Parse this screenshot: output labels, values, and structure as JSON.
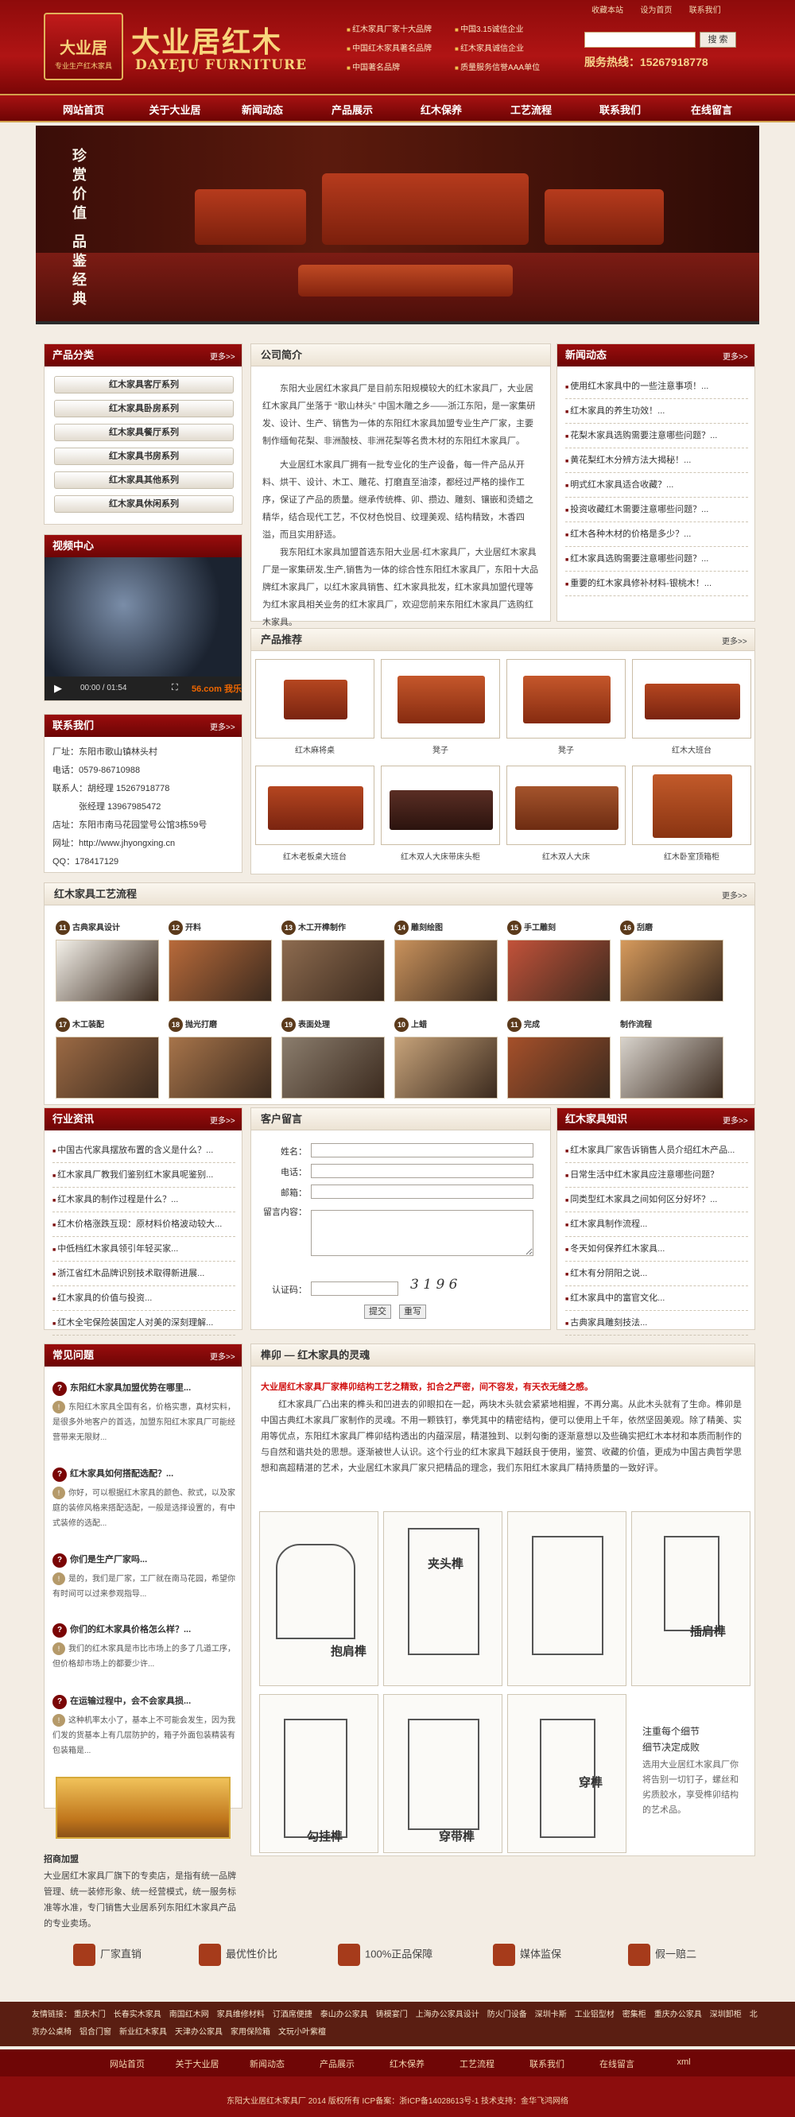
{
  "header": {
    "logo_text": "大业居",
    "logo_sub": "专业生产红木家具",
    "brand_cn": "大业居红木",
    "brand_en": "DAYEJU FURNITURE",
    "honors": [
      "红木家具厂家十大品牌",
      "中国3.15诚信企业",
      "中国红木家具著名品牌",
      "红木家具诚信企业",
      "中国著名品牌",
      "质量服务信誉AAA单位"
    ],
    "top_links": [
      "收藏本站",
      "设为首页",
      "联系我们"
    ],
    "search_button": "搜 索",
    "hotline": "服务热线：15267918778"
  },
  "nav": [
    "网站首页",
    "关于大业居",
    "新闻动态",
    "产品展示",
    "红木保养",
    "工艺流程",
    "联系我们",
    "在线留言"
  ],
  "banner": {
    "slogan": "珍赏价值 品鉴经典"
  },
  "categories": {
    "title": "产品分类",
    "more": "更多>>",
    "items": [
      "红木家具客厅系列",
      "红木家具卧房系列",
      "红木家具餐厅系列",
      "红木家具书房系列",
      "红木家具其他系列",
      "红木家具休闲系列"
    ]
  },
  "company": {
    "title": "公司简介",
    "p1": "东阳大业居红木家具厂是目前东阳规模较大的红木家具厂，大业居红木家具厂坐落于 “歌山林头” 中国木雕之乡——浙江东阳，是一家集研发、设计、生产、销售为一体的东阳红木家具加盟专业生产厂家，主要制作缅甸花梨、非洲酸枝、非洲花梨等名贵木材的东阳红木家具厂。",
    "p2": "大业居红木家具厂拥有一批专业化的生产设备，每一件产品从开料、烘干、设计、木工、雕花、打磨直至油漆，都经过严格的操作工序，保证了产品的质量。继承传统榫、卯、攒边、雕刻、镶嵌和烫蜡之精华，结合现代工艺，不仅材色悦目、纹理美观、结构精致，木香四溢，而且实用舒适。",
    "p3": "我东阳红木家具加盟首选东阳大业居-红木家具厂，大业居红木家具厂是一家集研发,生产,销售为一体的综合性东阳红木家具厂，东阳十大品牌红木家具厂，以红木家具销售、红木家具批发，红木家具加盟代理等为红木家具相关业务的红木家具厂，欢迎您前来东阳红木家具厂选购红木家具。"
  },
  "news": {
    "title": "新闻动态",
    "more": "更多>>",
    "items": [
      "使用红木家具中的一些注意事项！...",
      "红木家具的养生功效！...",
      "花梨木家具选购需要注意哪些问题？...",
      "黄花梨红木分辨方法大揭秘！...",
      "明式红木家具适合收藏？...",
      "投资收藏红木需要注意哪些问题？...",
      "红木各种木材的价格是多少？...",
      "红木家具选购需要注意哪些问题？...",
      "重要的红木家具修补材料-银桃木！..."
    ]
  },
  "video": {
    "title": "视频中心",
    "time": "00:00 / 01:54",
    "logo": "56.com 我乐"
  },
  "contact": {
    "title": "联系我们",
    "more": "更多>>",
    "lines": [
      "厂址：东阳市歌山镇林头村",
      "电话：0579-86710988",
      "联系人：胡经理 15267918778",
      "　　　张经理 13967985472",
      "店址：东阳市南马花园堂号公馆3栋59号",
      "网址：http://www.jhyongxing.cn",
      "QQ：178417129"
    ]
  },
  "products": {
    "title": "产品推荐",
    "more": "更多>>",
    "captions": [
      "红木麻将桌",
      "凳子",
      "凳子",
      "红木大班台",
      "红木老板桌大班台",
      "红木双人大床带床头柜",
      "红木双人大床",
      "红木卧室顶箱柜"
    ]
  },
  "process": {
    "title": "红木家具工艺流程",
    "more": "更多>>",
    "steps": [
      {
        "num": "11",
        "label": "古典家具设计"
      },
      {
        "num": "12",
        "label": "开料"
      },
      {
        "num": "13",
        "label": "木工开榫制作"
      },
      {
        "num": "14",
        "label": "雕刻绘图"
      },
      {
        "num": "15",
        "label": "手工雕刻"
      },
      {
        "num": "16",
        "label": "刮磨"
      },
      {
        "num": "17",
        "label": "木工装配"
      },
      {
        "num": "18",
        "label": "抛光打磨"
      },
      {
        "num": "19",
        "label": "表面处理"
      },
      {
        "num": "10",
        "label": "上蜡"
      },
      {
        "num": "11",
        "label": "完成"
      },
      {
        "num": "",
        "label": "制作流程"
      }
    ]
  },
  "industry": {
    "title": "行业资讯",
    "more": "更多>>",
    "items": [
      "中国古代家具摆放布置的含义是什么？...",
      "红木家具厂教我们鉴别红木家具呢鉴别...",
      "红木家具的制作过程是什么？...",
      "红木价格涨跌互现：原材料价格波动较大...",
      "中低档红木家具领引年轻买家...",
      "浙江省红木品牌识别技术取得新进展...",
      "红木家具的价值与投资...",
      "红木全宅保险装国定人对美的深刻理解..."
    ]
  },
  "message": {
    "title": "客户留言",
    "name_label": "姓名：",
    "phone_label": "电话：",
    "email_label": "邮箱：",
    "content_label": "留言内容：",
    "code_label": "认证码：",
    "captcha": "3 1 9 6",
    "submit": "提交",
    "reset": "重写"
  },
  "knowledge": {
    "title": "红木家具知识",
    "more": "更多>>",
    "items": [
      "红木家具厂家告诉销售人员介绍红木产品...",
      "日常生活中红木家具应注意哪些问题？",
      "同类型红木家具之间如何区分好坏？...",
      "红木家具制作流程...",
      "冬天如何保养红木家具...",
      "红木有分阴阳之说...",
      "红木家具中的富官文化...",
      "古典家具雕刻技法..."
    ]
  },
  "faq": {
    "title": "常见问题",
    "more": "更多>>",
    "items": [
      {
        "q": "东阳红木家具加盟优势在哪里...",
        "a": "东阳红木家具全国有名，价格实惠，真材实料，是很多外地客户的首选，加盟东阳红木家具厂可能经营带来无限财..."
      },
      {
        "q": "红木家具如何搭配选配？...",
        "a": "你好，可以根据红木家具的颜色、款式，以及家庭的装修风格来搭配选配，一般是选择设置的，有中式装修的选配..."
      },
      {
        "q": "你们是生产厂家吗...",
        "a": "是的，我们是厂家，工厂就在南马花园，希望你有时间可以过来参观指导..."
      },
      {
        "q": "你们的红木家具价格怎么样？...",
        "a": "我们的红木家具是市比市场上的多了几道工序，但价格却市场上的都要少许..."
      },
      {
        "q": "在运输过程中，会不会家具损...",
        "a": "这种机率太小了，基本上不可能会发生，因为我们发的货基本上有几层防护的，箱子外面包装精装有包装箱是..."
      }
    ]
  },
  "recruit": {
    "title": "招商加盟",
    "text": "大业居红木家具厂旗下的专卖店，是指有统一品牌管理、统一装修形象、统一经营模式，统一服务标准等水准，专门销售大业居系列东阳红木家具产品的专业卖场。"
  },
  "mortise": {
    "title": "榫卯 — 红木家具的灵魂",
    "lead": "大业居红木家具厂家榫卯结构工艺之精致，扣合之严密，间不容发，有天衣无缝之感。",
    "body": "红木家具厂凸出来的榫头和凹进去的卯眼扣在一起，两块木头就会紧紧地相握，不再分离。从此木头就有了生命。榫卯是中国古典红木家具厂家制作的灵魂。不用一颗铁钉，拳凭其中的精密结构，便可以使用上千年，依然坚固美观。除了精美、实用等优点，东阳红木家具厂榫卯结构透出的内蕴深层，精湛独到、以刺勾衡的逐渐意想以及些确实把红木本材和本质而制作的与自然和谐共处的思想。逐渐被世人认识。这个行业的红木家具下越跃良于使用，鉴赏、收藏的价值，更成为中国古典哲学思想和高超精湛的艺术，大业居红木家具厂家只把精品的理念，我们东阳红木家具厂精持质量的一致好评。",
    "labels": [
      "抱肩榫",
      "夹头榫",
      "插肩榫",
      "勾挂榫",
      "穿带榫",
      "穿榫"
    ],
    "note_title": "注重每个细节",
    "note_sub": "细节决定成败",
    "note_body": "选用大业居红木家具厂你将告别一切钉子，螺丝和劣质胶水，享受榫卯结构的艺术品。"
  },
  "features": [
    "厂家直销",
    "最优性价比",
    "100%正品保障",
    "媒体监保",
    "假一赔二"
  ],
  "friend_links": {
    "label": "友情链接：",
    "items": [
      "重庆木门",
      "长春实木家具",
      "南国红木网",
      "家具维修材料",
      "订酒席便捷",
      "泰山办公家具",
      "铸模宴门",
      "上海办公家具设计",
      "防火门设备",
      "深圳卡斯",
      "工业铝型材",
      "密集柜",
      "重庆办公家具",
      "深圳卸柜",
      "北京办公桌椅",
      "铝合门窗",
      "新业红木家具",
      "天津办公家具",
      "家用保险箱",
      "文玩小叶紫檀"
    ]
  },
  "footer": {
    "nav": [
      "网站首页",
      "关于大业居",
      "新闻动态",
      "产品展示",
      "红木保养",
      "工艺流程",
      "联系我们",
      "在线留言",
      "xml"
    ],
    "copyright": "东阳大业居红木家具厂 2014 版权所有 ICP备案：浙ICP备14028613号-1 技术支持：金华飞鸿网络"
  }
}
